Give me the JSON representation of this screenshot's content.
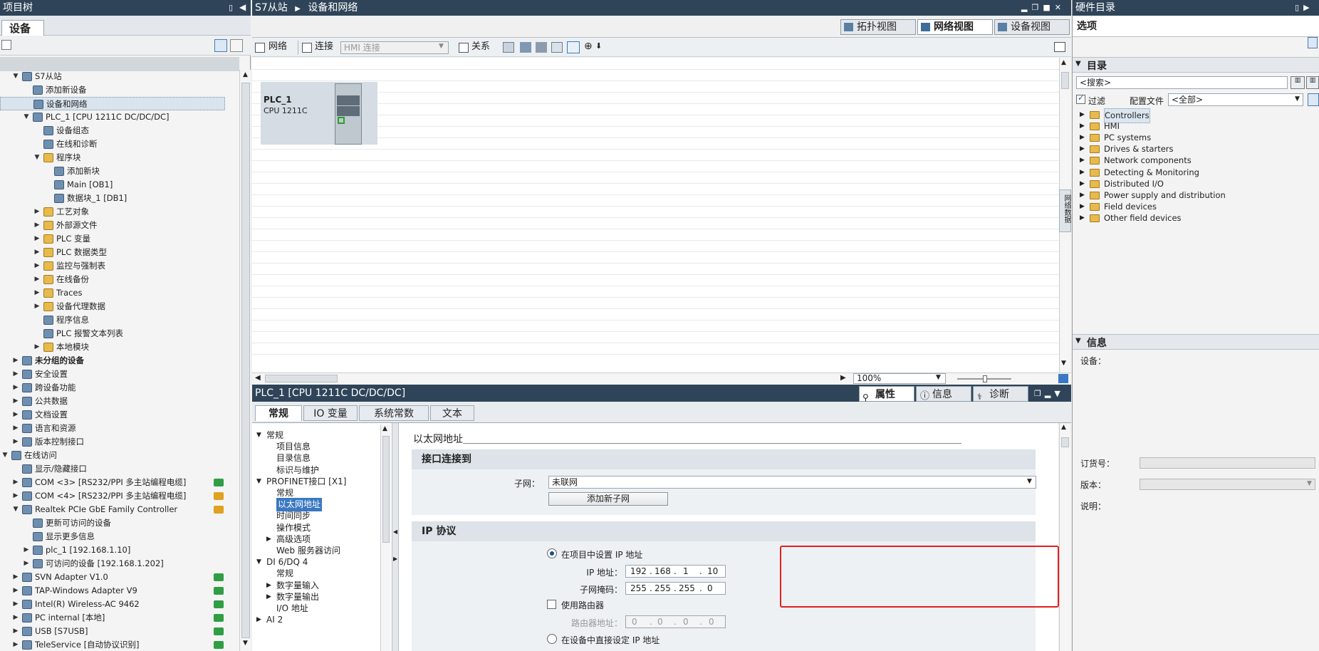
{
  "left_panel": {
    "title": "项目树",
    "tab": "设备",
    "items": [
      {
        "label": "S7从站",
        "depth": 0,
        "expanded": true,
        "icon": "project-icon"
      },
      {
        "label": "添加新设备",
        "depth": 1,
        "icon": "add-device-icon"
      },
      {
        "label": "设备和网络",
        "depth": 1,
        "icon": "network-icon",
        "selected": true
      },
      {
        "label": "PLC_1 [CPU 1211C DC/DC/DC]",
        "depth": 1,
        "expanded": true,
        "icon": "plc-icon"
      },
      {
        "label": "设备组态",
        "depth": 2,
        "icon": "device-config-icon"
      },
      {
        "label": "在线和诊断",
        "depth": 2,
        "icon": "diagnostics-icon"
      },
      {
        "label": "程序块",
        "depth": 2,
        "expanded": true,
        "icon": "folder-icon"
      },
      {
        "label": "添加新块",
        "depth": 3,
        "icon": "add-block-icon"
      },
      {
        "label": "Main [OB1]",
        "depth": 3,
        "icon": "ob-icon"
      },
      {
        "label": "数据块_1 [DB1]",
        "depth": 3,
        "icon": "db-icon"
      },
      {
        "label": "工艺对象",
        "depth": 2,
        "collapsed": true,
        "icon": "folder-icon"
      },
      {
        "label": "外部源文件",
        "depth": 2,
        "collapsed": true,
        "icon": "folder-icon"
      },
      {
        "label": "PLC 变量",
        "depth": 2,
        "collapsed": true,
        "icon": "folder-icon"
      },
      {
        "label": "PLC 数据类型",
        "depth": 2,
        "collapsed": true,
        "icon": "folder-icon"
      },
      {
        "label": "监控与强制表",
        "depth": 2,
        "collapsed": true,
        "icon": "folder-icon"
      },
      {
        "label": "在线备份",
        "depth": 2,
        "collapsed": true,
        "icon": "folder-icon"
      },
      {
        "label": "Traces",
        "depth": 2,
        "collapsed": true,
        "icon": "folder-icon"
      },
      {
        "label": "设备代理数据",
        "depth": 2,
        "collapsed": true,
        "icon": "folder-icon"
      },
      {
        "label": "程序信息",
        "depth": 2,
        "icon": "info-icon"
      },
      {
        "label": "PLC 报警文本列表",
        "depth": 2,
        "icon": "list-icon"
      },
      {
        "label": "本地模块",
        "depth": 2,
        "collapsed": true,
        "icon": "folder-icon"
      },
      {
        "label": "未分组的设备",
        "depth": 0,
        "collapsed": true,
        "bold": true,
        "icon": "devices-icon"
      },
      {
        "label": "安全设置",
        "depth": 0,
        "collapsed": true,
        "icon": "security-icon"
      },
      {
        "label": "跨设备功能",
        "depth": 0,
        "collapsed": true,
        "icon": "cross-device-icon"
      },
      {
        "label": "公共数据",
        "depth": 0,
        "collapsed": true,
        "icon": "common-data-icon"
      },
      {
        "label": "文档设置",
        "depth": 0,
        "collapsed": true,
        "icon": "document-icon"
      },
      {
        "label": "语言和资源",
        "depth": 0,
        "collapsed": true,
        "icon": "language-icon"
      },
      {
        "label": "版本控制接口",
        "depth": 0,
        "collapsed": true,
        "icon": "version-control-icon"
      },
      {
        "label": "在线访问",
        "depth": -1,
        "expanded": true,
        "icon": "online-access-icon"
      },
      {
        "label": "显示/隐藏接口",
        "depth": 0,
        "icon": "toggle-interface-icon"
      },
      {
        "label": "COM <3> [RS232/PPI 多主站编程电缆]",
        "depth": 0,
        "collapsed": true,
        "icon": "com-icon",
        "badge": "green"
      },
      {
        "label": "COM <4> [RS232/PPI 多主站编程电缆]",
        "depth": 0,
        "collapsed": true,
        "icon": "com-icon",
        "badge": "orange"
      },
      {
        "label": "Realtek PCIe GbE Family Controller",
        "depth": 0,
        "expanded": true,
        "icon": "nic-icon",
        "badge": "orange"
      },
      {
        "label": "更新可访问的设备",
        "depth": 1,
        "icon": "refresh-icon"
      },
      {
        "label": "显示更多信息",
        "depth": 1,
        "icon": "more-info-icon"
      },
      {
        "label": "plc_1 [192.168.1.10]",
        "depth": 1,
        "collapsed": true,
        "icon": "plc-icon"
      },
      {
        "label": "可访问的设备 [192.168.1.202]",
        "depth": 1,
        "collapsed": true,
        "icon": "device-icon"
      },
      {
        "label": "SVN Adapter V1.0",
        "depth": 0,
        "collapsed": true,
        "icon": "nic-icon",
        "badge": "green"
      },
      {
        "label": "TAP-Windows Adapter V9",
        "depth": 0,
        "collapsed": true,
        "icon": "nic-icon",
        "badge": "green"
      },
      {
        "label": "Intel(R) Wireless-AC 9462",
        "depth": 0,
        "collapsed": true,
        "icon": "nic-icon",
        "badge": "green-check"
      },
      {
        "label": "PC internal [本地]",
        "depth": 0,
        "collapsed": true,
        "icon": "pc-icon",
        "badge": "green"
      },
      {
        "label": "USB [S7USB]",
        "depth": 0,
        "collapsed": true,
        "icon": "usb-icon",
        "badge": "green"
      },
      {
        "label": "TeleService [自动协议识别]",
        "depth": 0,
        "collapsed": true,
        "icon": "teleservice-icon",
        "badge": "green"
      }
    ]
  },
  "editor": {
    "breadcrumb_project": "S7从站",
    "breadcrumb_page": "设备和网络",
    "view_tabs": [
      "拓扑视图",
      "网络视图",
      "设备视图"
    ],
    "active_view": "网络视图",
    "toolbar": {
      "network": "网络",
      "connect": "连接",
      "hmi_connect": "HMI 连接",
      "relation": "关系"
    },
    "plc_block": {
      "name": "PLC_1",
      "cpu": "CPU 1211C"
    },
    "zoom": "100%",
    "side_tab": "网络数据"
  },
  "properties": {
    "title": "PLC_1 [CPU 1211C DC/DC/DC]",
    "right_tabs": [
      "属性",
      "信息",
      "诊断"
    ],
    "active_right_tab": "属性",
    "tabs": [
      "常规",
      "IO 变量",
      "系统常数",
      "文本"
    ],
    "active_tab": "常规",
    "nav": [
      {
        "label": "常规",
        "depth": 0,
        "expanded": true
      },
      {
        "label": "项目信息",
        "depth": 1
      },
      {
        "label": "目录信息",
        "depth": 1
      },
      {
        "label": "标识与维护",
        "depth": 1
      },
      {
        "label": "PROFINET接口 [X1]",
        "depth": 0,
        "expanded": true
      },
      {
        "label": "常规",
        "depth": 1
      },
      {
        "label": "以太网地址",
        "depth": 1,
        "selected": true
      },
      {
        "label": "时间同步",
        "depth": 1
      },
      {
        "label": "操作模式",
        "depth": 1
      },
      {
        "label": "高级选项",
        "depth": 1,
        "collapsed": true
      },
      {
        "label": "Web 服务器访问",
        "depth": 1
      },
      {
        "label": "DI 6/DQ 4",
        "depth": 0,
        "expanded": true
      },
      {
        "label": "常规",
        "depth": 1
      },
      {
        "label": "数字量输入",
        "depth": 1,
        "collapsed": true
      },
      {
        "label": "数字量输出",
        "depth": 1,
        "collapsed": true
      },
      {
        "label": "I/O 地址",
        "depth": 1
      },
      {
        "label": "AI 2",
        "depth": 0,
        "collapsed": true
      }
    ],
    "content": {
      "section_title": "以太网地址",
      "interface_header": "接口连接到",
      "subnet_label": "子网：",
      "subnet_value": "未联网",
      "add_subnet_button": "添加新子网",
      "ip_protocol_header": "IP 协议",
      "set_ip_in_project": "在项目中设置 IP 地址",
      "ip_label": "IP 地址：",
      "ip_value": [
        "192",
        "168",
        "1",
        "10"
      ],
      "mask_label": "子网掩码：",
      "mask_value": [
        "255",
        "255",
        "255",
        "0"
      ],
      "use_router": "使用路由器",
      "router_label": "路由器地址：",
      "router_value": [
        "0",
        "0",
        "0",
        "0"
      ],
      "set_ip_directly": "在设备中直接设定 IP 地址"
    }
  },
  "right_panel": {
    "title": "硬件目录",
    "options_title": "选项",
    "catalog_title": "目录",
    "search_placeholder": "<搜索>",
    "filter_label": "过滤",
    "profile_label": "配置文件",
    "profile_value": "<全部>",
    "categories": [
      "Controllers",
      "HMI",
      "PC systems",
      "Drives & starters",
      "Network components",
      "Detecting & Monitoring",
      "Distributed I/O",
      "Power supply and distribution",
      "Field devices",
      "Other field devices"
    ],
    "info_title": "信息",
    "device_label": "设备：",
    "order_label": "订货号：",
    "version_label": "版本：",
    "desc_label": "说明："
  },
  "colors": {
    "titlebar": "#2f4458",
    "highlight": "#e02020",
    "selection": "#3a78c2"
  }
}
